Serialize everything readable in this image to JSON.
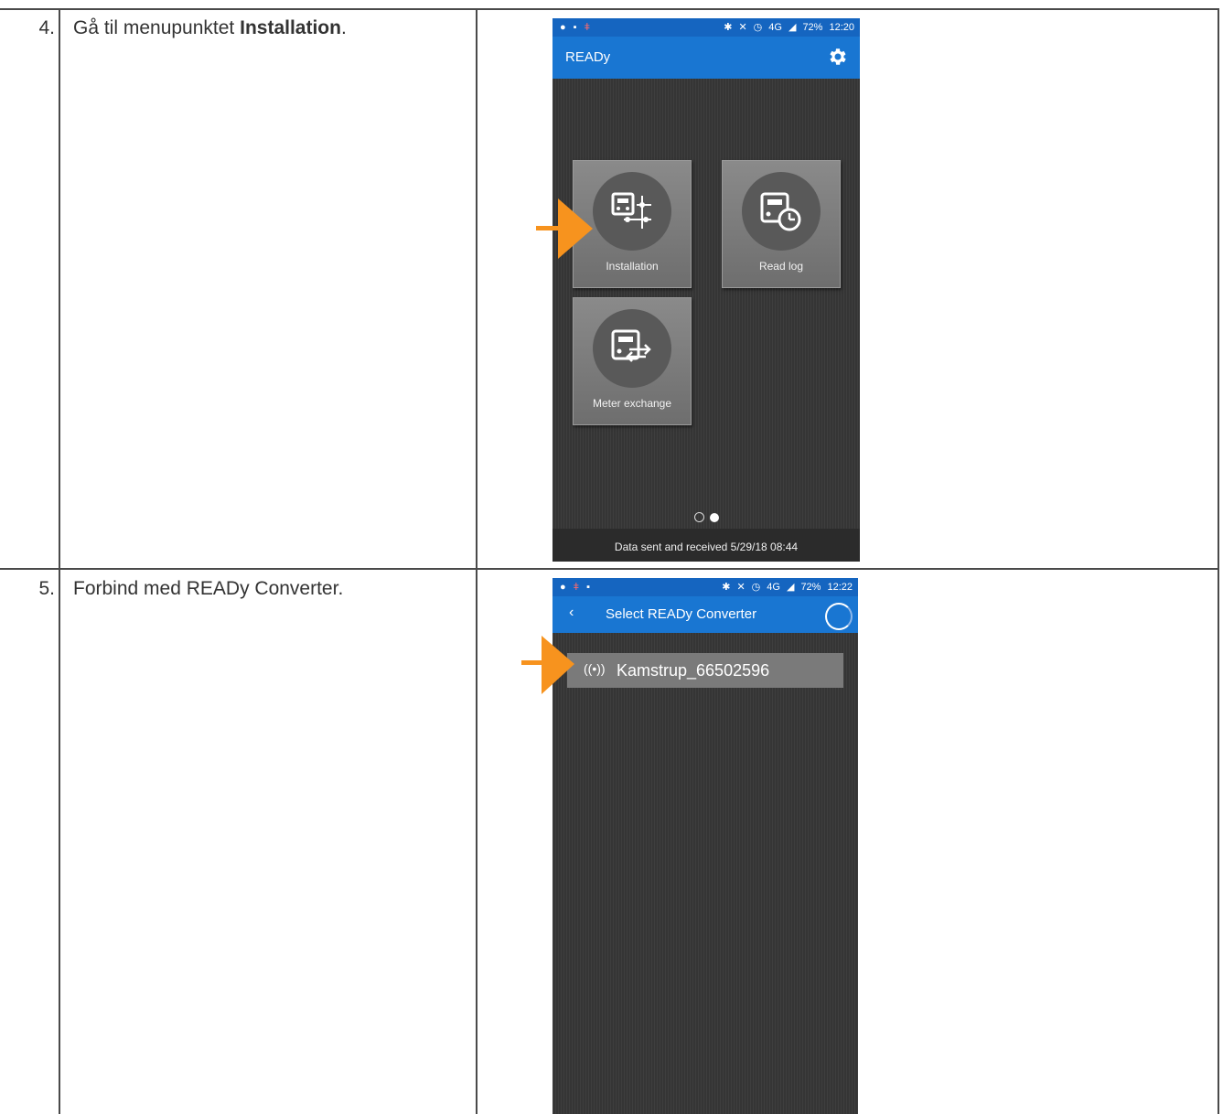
{
  "steps": [
    {
      "number": "4.",
      "text_pre": "Gå til menupunktet ",
      "text_bold": "Installation",
      "text_post": ".",
      "screen": {
        "status_time": "12:20",
        "status_battery": "72%",
        "status_network": "4G",
        "app_title": "READy",
        "tiles": [
          {
            "label": "Installation",
            "icon": "installation-icon"
          },
          {
            "label": "Read log",
            "icon": "read-log-icon"
          },
          {
            "label": "Meter exchange",
            "icon": "meter-exchange-icon"
          }
        ],
        "page_indicator": {
          "pages": 2,
          "active": 2
        },
        "footer": "Data sent and received 5/29/18 08:44"
      }
    },
    {
      "number": "5.",
      "text": "Forbind med READy Converter.",
      "screen": {
        "status_time": "12:22",
        "status_battery": "72%",
        "status_network": "4G",
        "toolbar_title": "Select READy Converter",
        "device": "Kamstrup_66502596"
      }
    }
  ],
  "colors": {
    "accent_arrow": "#f7931e",
    "toolbar": "#1976d2",
    "statusbar": "#1565c0"
  }
}
